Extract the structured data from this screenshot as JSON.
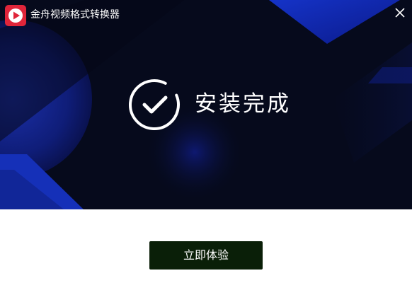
{
  "window": {
    "app_title": "金舟视频格式转换器",
    "logo_icon": "play-logo-icon",
    "close_icon": "close-icon"
  },
  "banner": {
    "status_text": "安装完成",
    "status_icon": "check-circle-icon"
  },
  "actions": {
    "primary_label": "立即体验"
  },
  "colors": {
    "banner_dark": "#060a1c",
    "banner_blue": "#1026a8",
    "logo_red": "#e0253a",
    "button_bg": "#0a1f08",
    "text_white": "#ffffff"
  }
}
